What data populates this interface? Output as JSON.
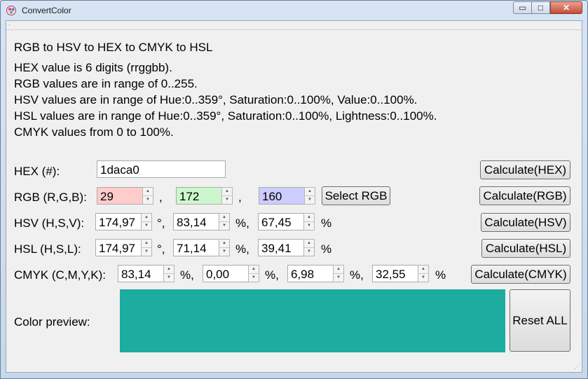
{
  "window": {
    "title": "ConvertColor"
  },
  "controls": {
    "minimize": "▭",
    "maximize": "□",
    "close": "✕"
  },
  "info": {
    "heading": "RGB to HSV to HEX to CMYK to HSL",
    "line1": "HEX value is 6 digits (rrggbb).",
    "line2": "RGB values are in range of 0..255.",
    "line3": "HSV values are in range of Hue:0..359°, Saturation:0..100%, Value:0..100%.",
    "line4": "HSL values are in range of Hue:0..359°, Saturation:0..100%, Lightness:0..100%.",
    "line5": "CMYK values from 0 to 100%."
  },
  "hex": {
    "label": "HEX (#):",
    "value": "1daca0",
    "button": "Calculate(HEX)"
  },
  "rgb": {
    "label": "RGB (R,G,B):",
    "r": "29",
    "g": "172",
    "b": "160",
    "sep1": ",",
    "sep2": ",",
    "select_button": "Select RGB",
    "button": "Calculate(RGB)"
  },
  "hsv": {
    "label": "HSV (H,S,V):",
    "h": "174,97",
    "s": "83,14",
    "v": "67,45",
    "deg": "°,",
    "pct1": "%,",
    "pct2": "%",
    "button": "Calculate(HSV)"
  },
  "hsl": {
    "label": "HSL (H,S,L):",
    "h": "174,97",
    "s": "71,14",
    "l": "39,41",
    "deg": "°,",
    "pct1": "%,",
    "pct2": "%",
    "button": "Calculate(HSL)"
  },
  "cmyk": {
    "label": "CMYK (C,M,Y,K):",
    "c": "83,14",
    "m": "0,00",
    "y": "6,98",
    "k": "32,55",
    "pct1": "%,",
    "pct2": "%,",
    "pct3": "%,",
    "pct4": "%",
    "button": "Calculate(CMYK)"
  },
  "preview": {
    "label": "Color preview:",
    "color": "#1dac a0",
    "reset_button": "Reset ALL"
  },
  "colors": {
    "preview_fill": "#1daca0",
    "red_field": "#ffcccc",
    "green_field": "#ccf7cc",
    "blue_field": "#ccccff"
  }
}
